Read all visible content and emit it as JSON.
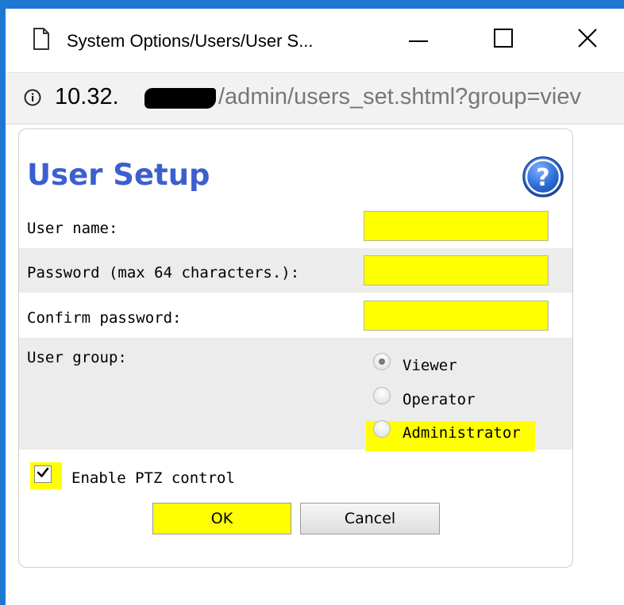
{
  "window": {
    "title": "System Options/Users/User S..."
  },
  "address_bar": {
    "url_host": "10.32.",
    "url_path": "/admin/users_set.shtml?group=viev"
  },
  "page": {
    "title": "User Setup",
    "help_icon": "question-mark-icon"
  },
  "form": {
    "username_label": "User name:",
    "username_value": "",
    "password_label": "Password (max 64 characters.):",
    "password_value": "",
    "confirm_label": "Confirm password:",
    "confirm_value": "",
    "user_group_label": "User group:",
    "user_group_options": [
      "Viewer",
      "Operator",
      "Administrator"
    ],
    "user_group_selected": "Viewer",
    "ptz_label": "Enable PTZ control",
    "ptz_checked": true
  },
  "buttons": {
    "ok_label": "OK",
    "cancel_label": "Cancel"
  },
  "colors": {
    "accent": "#1e78d2",
    "title_blue": "#3c5fcf",
    "highlight": "#ffff00"
  }
}
